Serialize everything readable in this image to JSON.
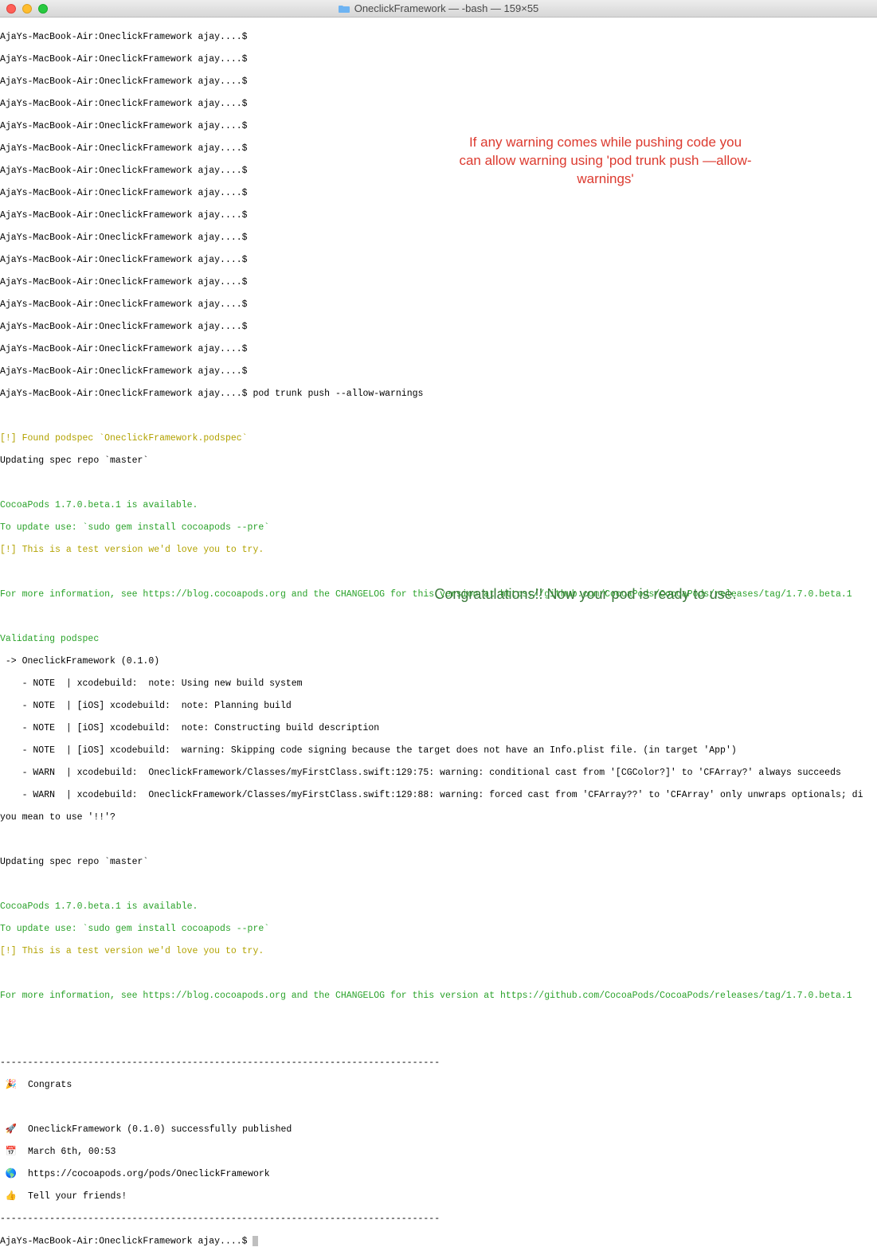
{
  "window": {
    "title": "OneclickFramework — -bash — 159×55"
  },
  "prompt_line": "AjaYs-MacBook-Air:OneclickFramework ajay....$",
  "command": "pod trunk push --allow-warnings",
  "found_podspec": "[!] Found podspec `OneclickFramework.podspec`",
  "updating_master": "Updating spec repo `master`",
  "version_avail": "CocoaPods 1.7.0.beta.1 is available.",
  "update_use": "To update use: `sudo gem install cocoapods --pre`",
  "test_version": "[!] This is a test version we'd love you to try.",
  "more_info": "For more information, see https://blog.cocoapods.org and the CHANGELOG for this version at https://github.com/CocoaPods/CocoaPods/releases/tag/1.7.0.beta.1",
  "validating": "Validating podspec",
  "arrow_line": " -> OneclickFramework (0.1.0)",
  "notes": [
    "    - NOTE  | xcodebuild:  note: Using new build system",
    "    - NOTE  | [iOS] xcodebuild:  note: Planning build",
    "    - NOTE  | [iOS] xcodebuild:  note: Constructing build description",
    "    - NOTE  | [iOS] xcodebuild:  warning: Skipping code signing because the target does not have an Info.plist file. (in target 'App')",
    "    - WARN  | xcodebuild:  OneclickFramework/Classes/myFirstClass.swift:129:75: warning: conditional cast from '[CGColor?]' to 'CFArray?' always succeeds",
    "    - WARN  | xcodebuild:  OneclickFramework/Classes/myFirstClass.swift:129:88: warning: forced cast from 'CFArray??' to 'CFArray' only unwraps optionals; di"
  ],
  "did_you_mean": "you mean to use '!!'?",
  "dash_line": "--------------------------------------------------------------------------------",
  "congrats": {
    "emoji_congrats": " 🎉  Congrats",
    "emoji_published": " 🚀  OneclickFramework (0.1.0) successfully published",
    "emoji_date": " 📅  March 6th, 00:53",
    "emoji_url": " 🌎  https://cocoapods.org/pods/OneclickFramework",
    "emoji_tell": " 👍  Tell your friends!"
  },
  "final_prompt": "AjaYs-MacBook-Air:OneclickFramework ajay....$ ",
  "annotations": {
    "warning_annot": "If any warning comes while pushing code you can allow warning using 'pod trunk push —allow-warnings'",
    "congrats_annot": "Congratulations!! Now your pod is ready to use."
  }
}
